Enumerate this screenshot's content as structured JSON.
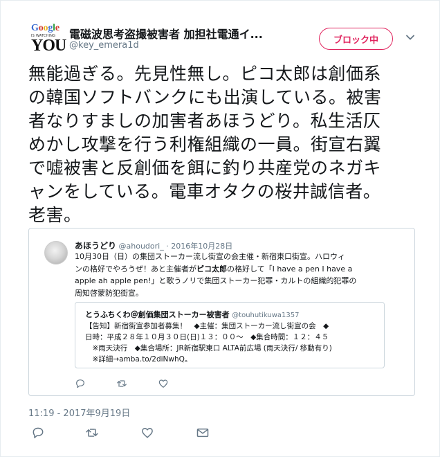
{
  "author": {
    "avatar_text": {
      "google": [
        "G",
        "o",
        "o",
        "g",
        "l",
        "e"
      ],
      "watching": "IS WATCHING",
      "you": "YOU"
    },
    "display_name": "電磁波思考盗撮被害者 加担社電通イ...",
    "screen_name": "@key_emera1d"
  },
  "block_button": {
    "label": "ブロック中"
  },
  "tweet": {
    "text": "無能過ぎる。先見性無し。ピコ太郎は創価系\nの韓国ソフトバンクにも出演している。被害\n者なりすましの加害者あほうどり。私生活仄\nめかし攻撃を行う利権組織の一員。街宣右翼\nで嘘被害と反創価を餌に釣り共産党のネガキ\nャンをしている。電車オタクの桜井誠信者。\n老害。",
    "timestamp": "11:19 - 2017年9月19日"
  },
  "quoted": {
    "name": "あほうどり",
    "handle": "@ahoudori_",
    "dot": "·",
    "date": "2016年10月28日",
    "lines": [
      "10月30日（日）の集団ストーカー流し街宣の会主催・新宿東口街宣。ハロウィ",
      "ンの格好でやろうぜ！あと主催者が",
      "ピコ太郎",
      "の格好して「I have a pen I have a",
      "apple ah apple pen!」と歌うノリで集団ストーカー犯罪・カルトの組織的犯罪の",
      "周知啓蒙防犯街宣。"
    ],
    "nested": {
      "name": "とうふちくわ＠創価集団ストーカー被害者",
      "handle": "@touhutikuwa1357",
      "lines": [
        "【告知】新宿街宣参加者募集！　◆主催：集団ストーカー流し街宣の会　◆",
        "日時：平成２８年１０月３０日(日)１３：００～　◆集合時間：１２：４５",
        "　※雨天決行　◆集合場所：JR新宿駅東口 ALTA前広場 (雨天決行/ 移動有り)",
        "　※詳細→amba.to/2diNwhQ。"
      ]
    }
  },
  "icons": {
    "reply": "reply-icon",
    "retweet": "retweet-icon",
    "like": "heart-icon",
    "dm": "envelope-icon",
    "caret": "chevron-down-icon"
  },
  "colors": {
    "block_red": "#e0245e",
    "secondary_text": "#657786",
    "border": "#ccd6dd",
    "icon_gray": "#657786"
  }
}
